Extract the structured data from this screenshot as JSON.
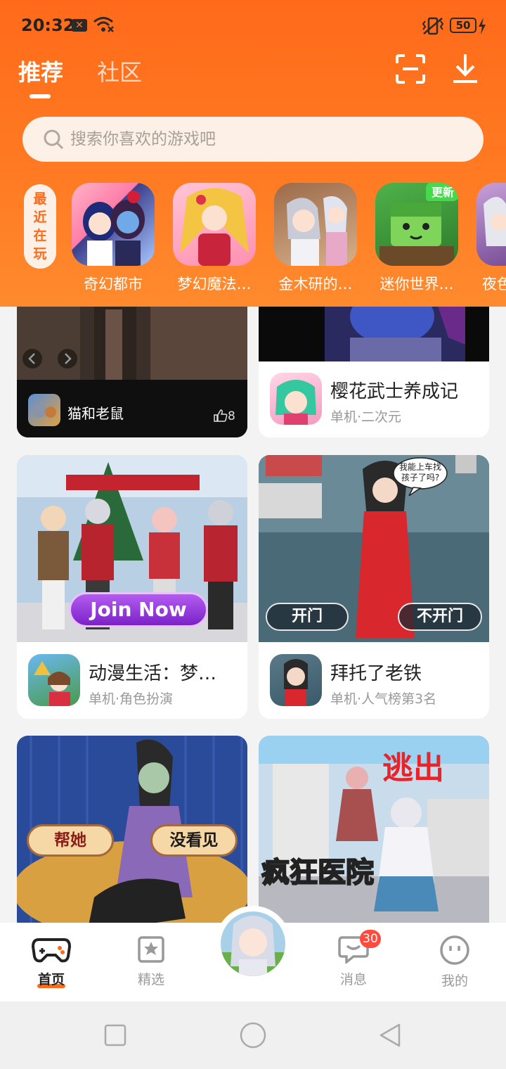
{
  "status_bar": {
    "time": "20:32",
    "battery": "50"
  },
  "header": {
    "tabs": [
      {
        "label": "推荐"
      },
      {
        "label": "社区"
      }
    ],
    "search": {
      "placeholder": "搜索你喜欢的游戏吧"
    }
  },
  "recent": {
    "tag": "最近在玩",
    "items": [
      {
        "label": "奇幻都市"
      },
      {
        "label": "梦幻魔法…"
      },
      {
        "label": "金木研的…"
      },
      {
        "label": "迷你世界…",
        "badge": "更新"
      },
      {
        "label": "夜色"
      }
    ]
  },
  "feed": {
    "cards": [
      {
        "title": "猫和老鼠",
        "likes": "8"
      },
      {
        "title": "樱花武士养成记",
        "subtitle": "单机·二次元"
      },
      {
        "title": "动漫生活：梦…",
        "subtitle": "单机·角色扮演",
        "image_text": "Join Now"
      },
      {
        "title": "拜托了老铁",
        "subtitle": "单机·人气榜第3名",
        "button_left": "开门",
        "button_right": "不开门",
        "speech": "我能上车找孩子了吗?"
      },
      {
        "button_left": "帮她",
        "button_right": "没看见"
      },
      {
        "image_title": "疯狂医院",
        "image_badge": "逃出"
      }
    ]
  },
  "bottom_nav": {
    "items": [
      {
        "label": "首页"
      },
      {
        "label": "精选"
      },
      {
        "label": "消息",
        "badge": "30"
      },
      {
        "label": "我的"
      }
    ]
  },
  "colors": {
    "brand": "#ff6a1a",
    "accent_bg": "#fdf1e7"
  }
}
